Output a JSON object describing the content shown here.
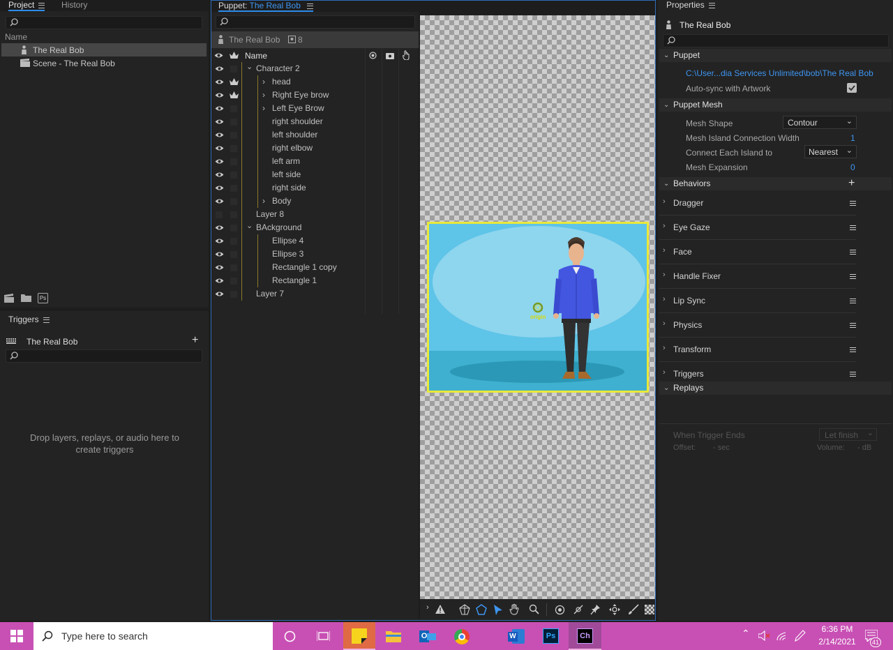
{
  "project": {
    "tabs": [
      "Project",
      "History"
    ],
    "column_name": "Name",
    "items": [
      {
        "label": "The Real Bob",
        "icon": "puppet-icon",
        "selected": true
      },
      {
        "label": "Scene - The Real Bob",
        "icon": "scene-icon",
        "selected": false
      }
    ]
  },
  "triggers": {
    "title": "Triggers",
    "puppet": "The Real Bob",
    "empty_text": "Drop layers, replays, or audio here to create triggers"
  },
  "puppet_panel": {
    "title_prefix": "Puppet:",
    "title_name": "The Real Bob",
    "header_name": "The Real Bob",
    "header_count": "8",
    "col_name": "Name",
    "layers": [
      {
        "label": "Character 2",
        "indent": 1,
        "expand": "down",
        "eye": true,
        "crown": false
      },
      {
        "label": "head",
        "indent": 2,
        "expand": "right",
        "eye": true,
        "crown": true
      },
      {
        "label": "Right Eye brow",
        "indent": 2,
        "expand": "right",
        "eye": true,
        "crown": true
      },
      {
        "label": "Left Eye Brow",
        "indent": 2,
        "expand": "right",
        "eye": true,
        "crown": false
      },
      {
        "label": "right shoulder",
        "indent": 2,
        "expand": "",
        "eye": true,
        "crown": false
      },
      {
        "label": "left shoulder",
        "indent": 2,
        "expand": "",
        "eye": true,
        "crown": false
      },
      {
        "label": "right elbow",
        "indent": 2,
        "expand": "",
        "eye": true,
        "crown": false
      },
      {
        "label": "left arm",
        "indent": 2,
        "expand": "",
        "eye": true,
        "crown": false
      },
      {
        "label": "left side",
        "indent": 2,
        "expand": "",
        "eye": true,
        "crown": false
      },
      {
        "label": "right side",
        "indent": 2,
        "expand": "",
        "eye": true,
        "crown": false
      },
      {
        "label": "Body",
        "indent": 2,
        "expand": "right",
        "eye": true,
        "crown": false
      },
      {
        "label": "Layer 8",
        "indent": 1,
        "expand": "",
        "eye": false,
        "crown": false
      },
      {
        "label": "BAckground",
        "indent": 1,
        "expand": "down",
        "eye": true,
        "crown": false
      },
      {
        "label": "Ellipse 4",
        "indent": 2,
        "expand": "",
        "eye": true,
        "crown": false
      },
      {
        "label": "Ellipse 3",
        "indent": 2,
        "expand": "",
        "eye": true,
        "crown": false
      },
      {
        "label": "Rectangle 1 copy",
        "indent": 2,
        "expand": "",
        "eye": true,
        "crown": false
      },
      {
        "label": "Rectangle 1",
        "indent": 2,
        "expand": "",
        "eye": true,
        "crown": false
      },
      {
        "label": "Layer 7",
        "indent": 1,
        "expand": "",
        "eye": true,
        "crown": false
      }
    ]
  },
  "canvas": {
    "origin_label": "origin",
    "frame_color": "#e8e83a",
    "sky_color": "#5ec4e8",
    "ground_color": "#3fb0cf"
  },
  "properties": {
    "title": "Properties",
    "puppet_name": "The Real Bob",
    "section_puppet": "Puppet",
    "path": "C:\\User...dia Services Unlimited\\bob\\The Real Bob",
    "autosync_label": "Auto-sync with Artwork",
    "section_mesh": "Puppet Mesh",
    "mesh_shape_label": "Mesh Shape",
    "mesh_shape_value": "Contour",
    "island_width_label": "Mesh Island Connection Width",
    "island_width_value": "1",
    "connect_label": "Connect Each Island to",
    "connect_value": "Nearest",
    "expansion_label": "Mesh Expansion",
    "expansion_value": "0",
    "section_behaviors": "Behaviors",
    "behaviors": [
      "Dragger",
      "Eye Gaze",
      "Face",
      "Handle Fixer",
      "Lip Sync",
      "Physics",
      "Transform",
      "Triggers"
    ],
    "section_replays": "Replays",
    "when_trigger_ends": "When Trigger Ends",
    "let_finish": "Let finish",
    "offset_label": "Offset:",
    "offset_value": "- sec",
    "volume_label": "Volume:",
    "volume_value": "- dB"
  },
  "taskbar": {
    "search_placeholder": "Type here to search",
    "time": "6:36 PM",
    "date": "2/14/2021",
    "notification_count": "41",
    "accent": "#c850b4"
  }
}
